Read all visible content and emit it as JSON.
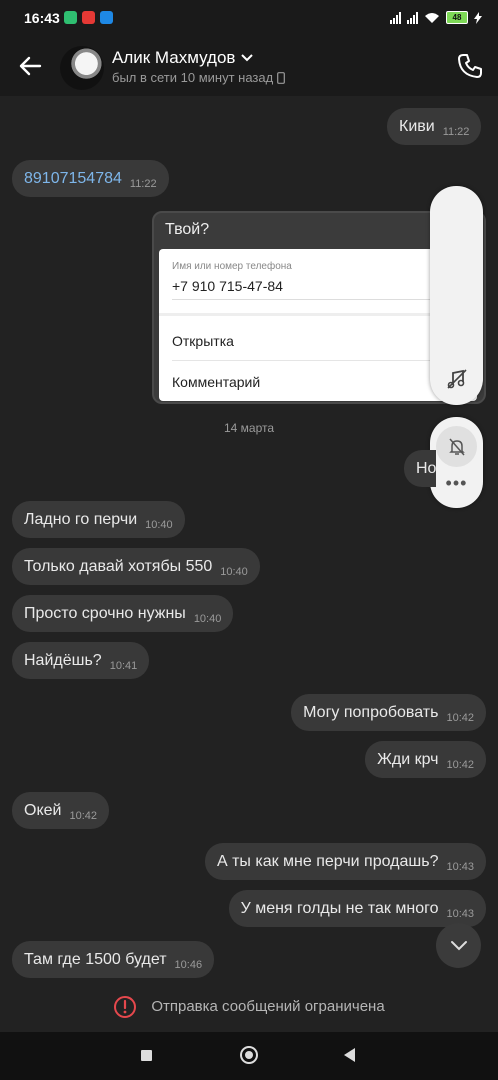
{
  "status_bar": {
    "time": "16:43",
    "battery": "48"
  },
  "header": {
    "contact_name": "Алик Махмудов",
    "presence": "был в сети 10 минут назад"
  },
  "messages": [
    {
      "text": "Киви",
      "time": "11:22",
      "side": "out"
    },
    {
      "text": "89107154784",
      "time": "11:22",
      "side": "in"
    },
    {
      "text": "Но",
      "side": "out"
    },
    {
      "text": "Ладно го перчи",
      "time": "10:40",
      "side": "in"
    },
    {
      "text": "Только давай хотябы 550",
      "time": "10:40",
      "side": "in"
    },
    {
      "text": "Просто срочно нужны",
      "time": "10:40",
      "side": "in"
    },
    {
      "text": "Найдёшь?",
      "time": "10:41",
      "side": "in"
    },
    {
      "text": "Могу попробовать",
      "time": "10:42",
      "side": "out"
    },
    {
      "text": "Жди крч",
      "time": "10:42",
      "side": "out"
    },
    {
      "text": "Окей",
      "time": "10:42",
      "side": "in"
    },
    {
      "text": "А ты как мне перчи продашь?",
      "time": "10:43",
      "side": "out"
    },
    {
      "text": "У меня голды не так много",
      "time": "10:43",
      "side": "out"
    },
    {
      "text": "Там где 1500 будет",
      "time": "10:46",
      "side": "in"
    }
  ],
  "date_separator": "14 марта",
  "payment_card": {
    "title": "Твой?",
    "field_label": "Имя или номер телефона",
    "field_value": "+7 910 715-47-84",
    "menu": [
      "Открытка",
      "Комментарий"
    ]
  },
  "restriction_text": "Отправка сообщений ограничена",
  "colors": {
    "background": "#222222",
    "bubble": "#393939",
    "link": "#7eb6ea",
    "warning": "#e5484d"
  }
}
